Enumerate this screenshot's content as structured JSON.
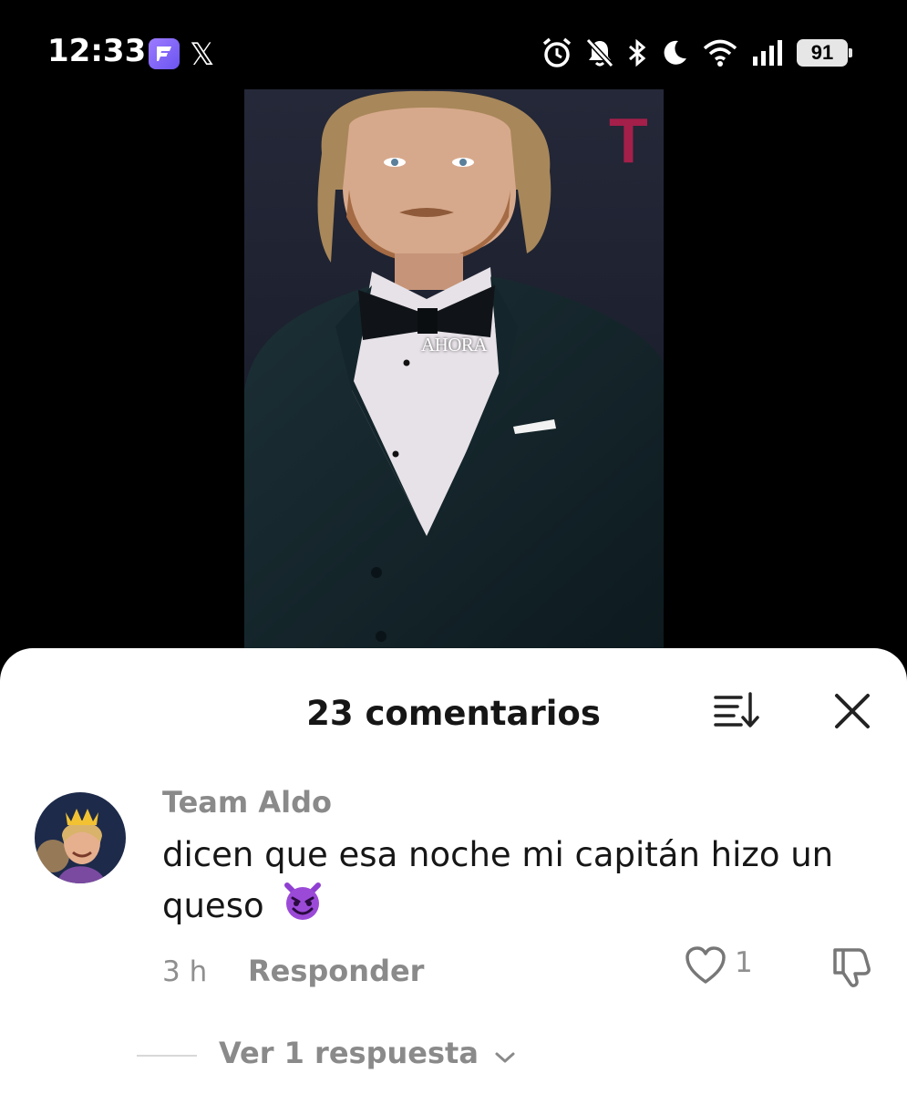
{
  "status_bar": {
    "time": "12:33",
    "app_icons": [
      "f-app-icon",
      "x-icon"
    ],
    "x_glyph": "𝕏",
    "system_icons": [
      "alarm-icon",
      "notifications-muted-icon",
      "bluetooth-icon",
      "do-not-disturb-moon-icon",
      "wifi-icon",
      "signal-icon"
    ],
    "battery": "91"
  },
  "video": {
    "overlay_text": "AHORA"
  },
  "comments": {
    "title": "23 comentarios",
    "items": [
      {
        "username": "Team Aldo",
        "text": "dicen que esa noche mi capitán hizo un queso",
        "emoji": "smiling-devil-emoji",
        "time": "3 h",
        "reply_label": "Responder",
        "likes": "1",
        "view_replies": "Ver 1 respuesta"
      }
    ]
  },
  "colors": {
    "accent_purple": "#8b5cf6",
    "muted_text": "#8a8a8a",
    "primary_text": "#161616"
  }
}
